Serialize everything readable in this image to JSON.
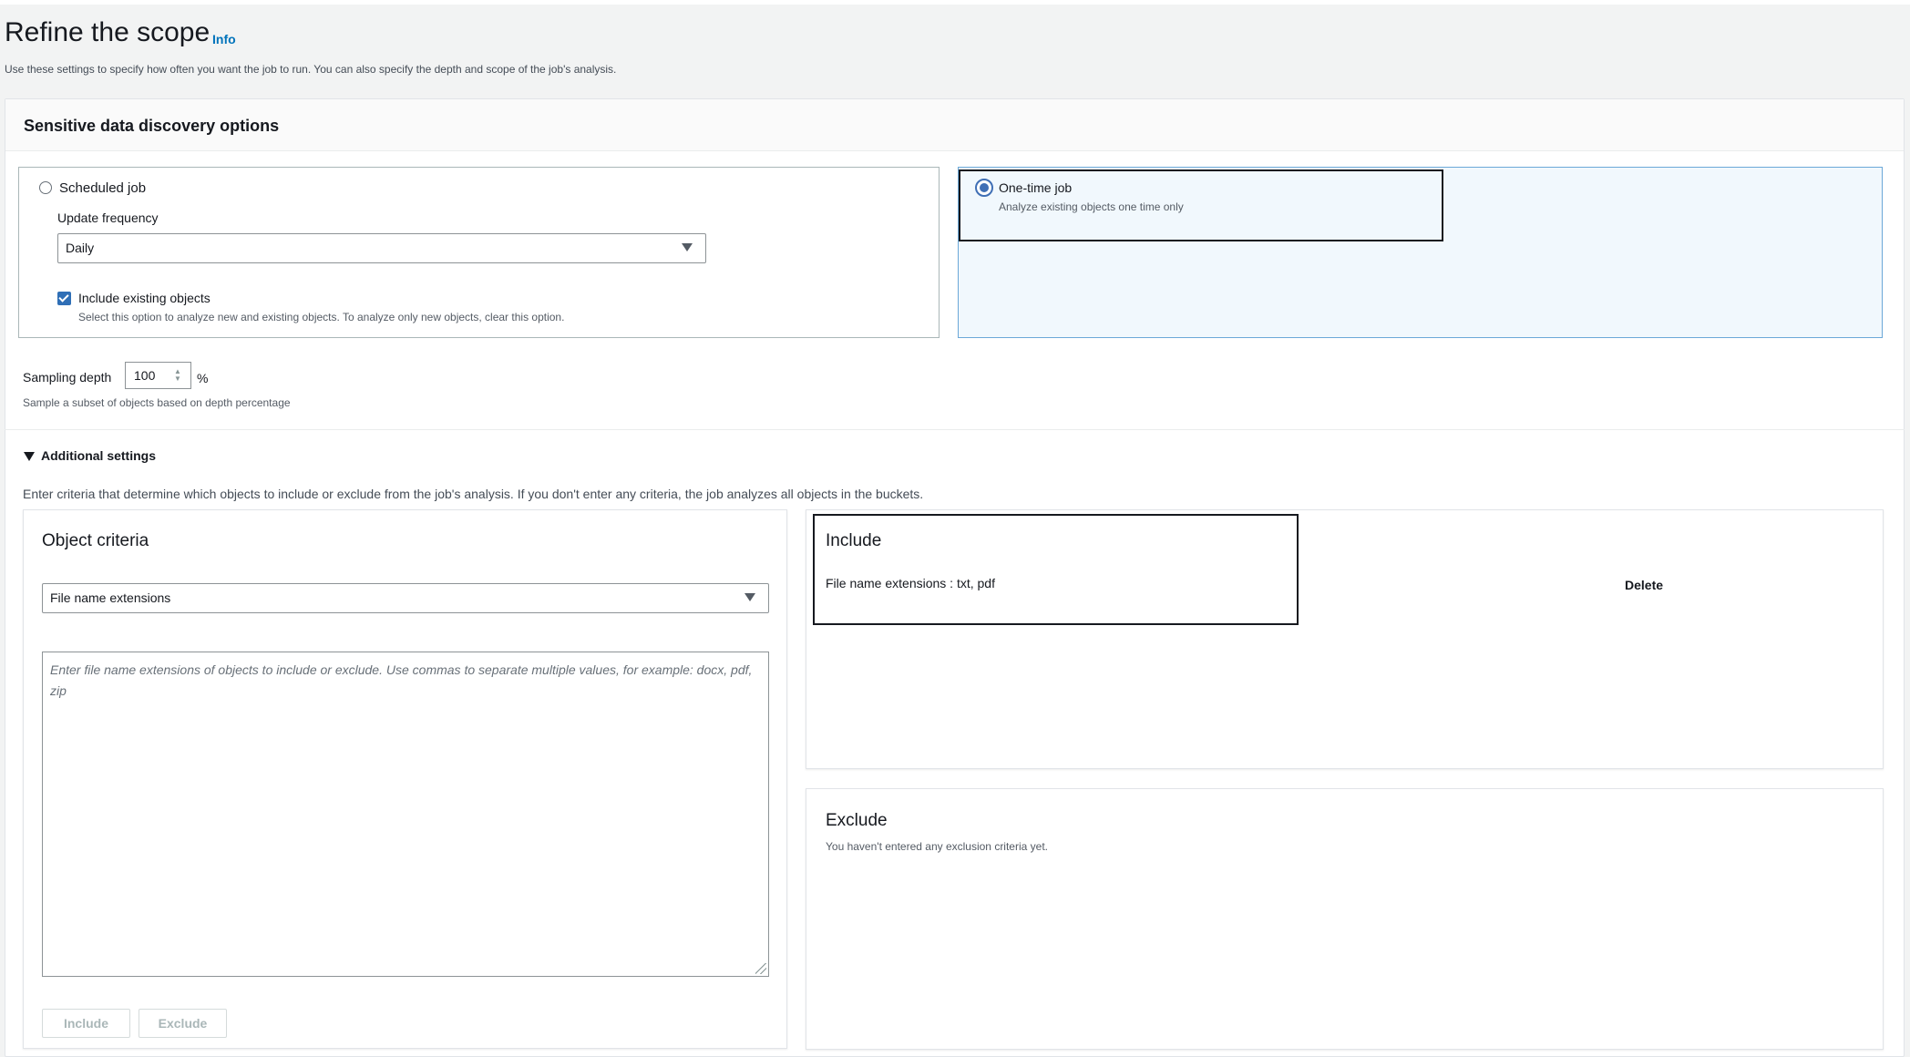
{
  "page": {
    "title": "Refine the scope",
    "info_link": "Info",
    "description": "Use these settings to specify how often you want the job to run. You can also specify the depth and scope of the job's analysis."
  },
  "discovery": {
    "title": "Sensitive data discovery options",
    "scheduled": {
      "label": "Scheduled job",
      "selected": false,
      "frequency_label": "Update frequency",
      "frequency_value": "Daily",
      "include_existing_label": "Include existing objects",
      "include_existing_checked": true,
      "include_existing_hint": "Select this option to analyze new and existing objects. To analyze only new objects, clear this option."
    },
    "onetime": {
      "label": "One-time job",
      "selected": true,
      "description": "Analyze existing objects one time only"
    },
    "sampling": {
      "label": "Sampling depth",
      "value": "100",
      "unit": "%",
      "hint": "Sample a subset of objects based on depth percentage"
    }
  },
  "additional": {
    "toggle_label": "Additional settings",
    "expanded": true,
    "description": "Enter criteria that determine which objects to include or exclude from the job's analysis. If you don't enter any criteria, the job analyzes all objects in the buckets.",
    "criteria": {
      "title": "Object criteria",
      "type_value": "File name extensions",
      "placeholder": "Enter file name extensions of objects to include or exclude. Use commas to separate multiple values, for example: docx, pdf, zip",
      "include_button": "Include",
      "exclude_button": "Exclude"
    },
    "include_panel": {
      "title": "Include",
      "entry": "File name extensions : txt, pdf",
      "delete_label": "Delete"
    },
    "exclude_panel": {
      "title": "Exclude",
      "empty_text": "You haven't entered any exclusion criteria yet."
    }
  }
}
